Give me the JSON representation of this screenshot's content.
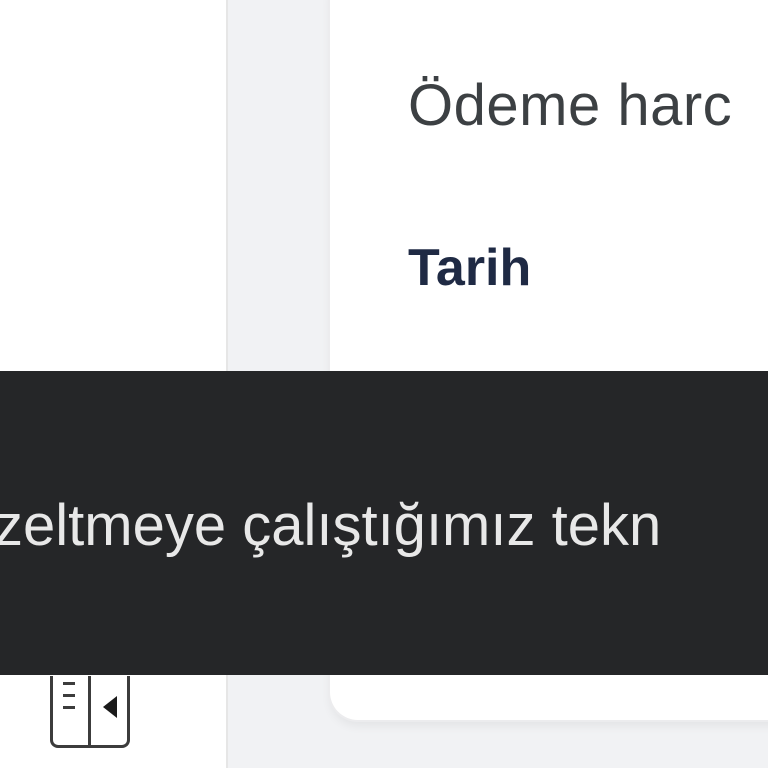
{
  "card": {
    "title": "Ödeme harc",
    "column_header": "Tarih"
  },
  "snackbar": {
    "message": "zeltmeye çalıştığımız tekn"
  },
  "toolbar": {
    "panel_toggle_icon": "sidebar-collapse-icon"
  },
  "colors": {
    "snackbar_bg": "#252628",
    "snackbar_text": "#e8e8e8",
    "title_text": "#3c4043",
    "header_text": "#1f2a44",
    "main_bg": "#f1f2f4"
  }
}
